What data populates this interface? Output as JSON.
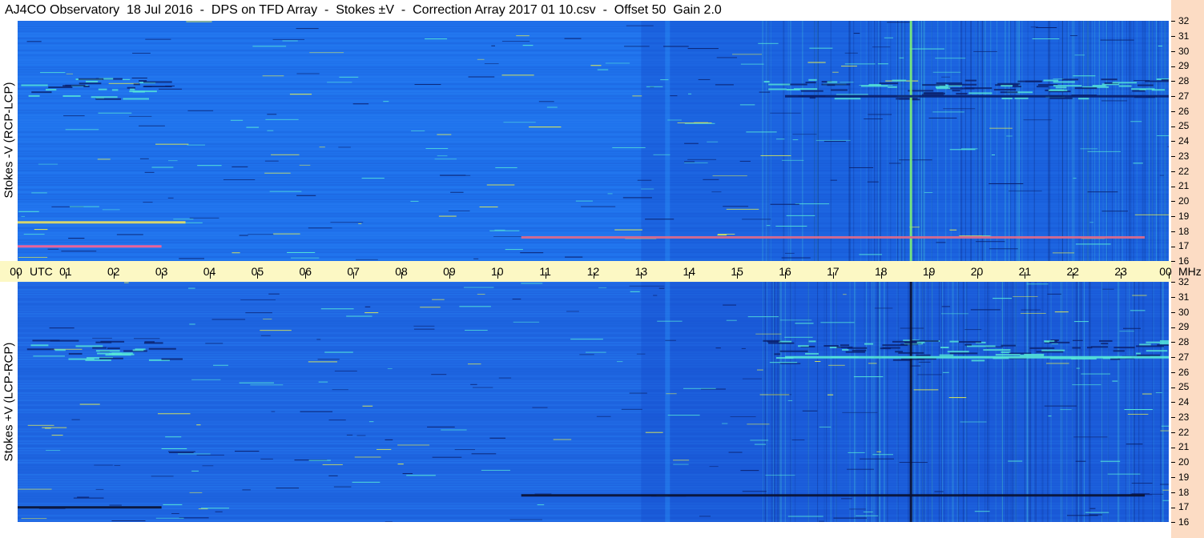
{
  "title": "AJ4CO Observatory  18 Jul 2016  -  DPS on TFD Array  -  Stokes ±V  -  Correction Array 2017 01 10.csv  -  Offset 50  Gain 2.0",
  "time_axis": {
    "labels": [
      "00",
      "01",
      "02",
      "03",
      "04",
      "05",
      "06",
      "07",
      "08",
      "09",
      "10",
      "11",
      "12",
      "13",
      "14",
      "15",
      "16",
      "17",
      "18",
      "19",
      "20",
      "21",
      "22",
      "23",
      "00"
    ],
    "utc_label": "UTC",
    "mhz_label": "MHz"
  },
  "chart_data": [
    {
      "type": "heatmap",
      "panel": "top",
      "ylabel": "Stokes -V (RCP-LCP)",
      "y_ticks": [
        32,
        31,
        30,
        29,
        28,
        27,
        26,
        25,
        24,
        23,
        22,
        21,
        20,
        19,
        18,
        17,
        16
      ],
      "ylim": [
        16,
        32
      ],
      "y_unit": "MHz",
      "xlim_hours": [
        0,
        24
      ],
      "colormap": [
        "#0a1f6b",
        "#1f6fe8",
        "#2f9cff",
        "#56e8d8",
        "#e8f050",
        "#ff4070"
      ],
      "background_value": "medium blue",
      "features": [
        {
          "kind": "vertical_line",
          "hour": 18.6,
          "color": "#7ef07a"
        },
        {
          "kind": "band",
          "mhz": 17.6,
          "hour_start": 10.5,
          "hour_end": 23.5,
          "color": "#e06a8a"
        },
        {
          "kind": "band",
          "mhz": 17.0,
          "hour_start": 0.0,
          "hour_end": 3.0,
          "color": "#ff6090"
        },
        {
          "kind": "band",
          "mhz": 18.6,
          "hour_start": 0.0,
          "hour_end": 3.5,
          "color": "#e8e060"
        },
        {
          "kind": "band",
          "mhz": 27.0,
          "hour_start": 16.0,
          "hour_end": 24.0,
          "color": "#0a1f6b"
        }
      ]
    },
    {
      "type": "heatmap",
      "panel": "bottom",
      "ylabel": "Stokes +V (LCP-RCP)",
      "y_ticks": [
        32,
        31,
        30,
        29,
        28,
        27,
        26,
        25,
        24,
        23,
        22,
        21,
        20,
        19,
        18,
        17,
        16
      ],
      "ylim": [
        16,
        32
      ],
      "y_unit": "MHz",
      "xlim_hours": [
        0,
        24
      ],
      "colormap": [
        "#0a1f6b",
        "#1f6fe8",
        "#2f9cff",
        "#56e8d8",
        "#e8f050"
      ],
      "background_value": "medium-dark blue",
      "features": [
        {
          "kind": "vertical_line",
          "hour": 18.6,
          "color": "#0a1030"
        },
        {
          "kind": "band",
          "mhz": 17.8,
          "hour_start": 10.5,
          "hour_end": 23.5,
          "color": "#0a1030"
        },
        {
          "kind": "band",
          "mhz": 17.0,
          "hour_start": 0.0,
          "hour_end": 3.0,
          "color": "#0a1030"
        },
        {
          "kind": "band",
          "mhz": 27.0,
          "hour_start": 16.0,
          "hour_end": 24.0,
          "color": "#56e8d8"
        }
      ]
    }
  ]
}
